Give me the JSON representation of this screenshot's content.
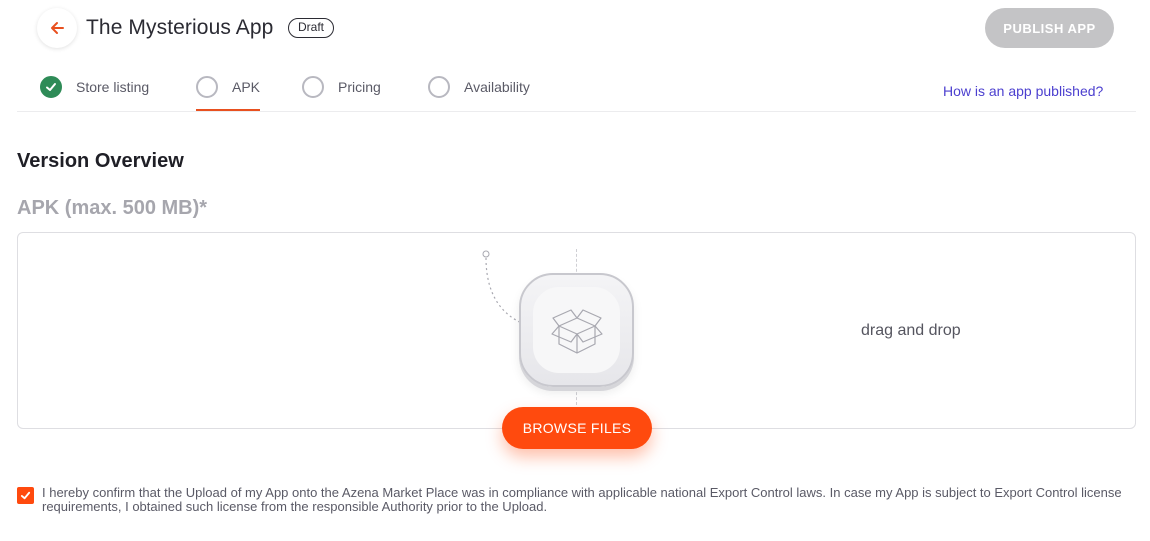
{
  "header": {
    "app_title": "The Mysterious App",
    "status_badge": "Draft",
    "publish_label": "PUBLISH APP",
    "back_icon": "arrow-left-icon",
    "accent_color": "#e8501f"
  },
  "tabs": [
    {
      "label": "Store listing",
      "state": "done"
    },
    {
      "label": "APK",
      "state": "active"
    },
    {
      "label": "Pricing",
      "state": "pending"
    },
    {
      "label": "Availability",
      "state": "pending"
    }
  ],
  "help_link": "How is an app published?",
  "main": {
    "section_title": "Version Overview",
    "apk_label": "APK (max. 500 MB)*",
    "drag_text": "drag and drop",
    "browse_label": "BROWSE FILES",
    "box_icon": "package-box-icon"
  },
  "confirm": {
    "checked": true,
    "text": "I hereby confirm that the Upload of my App onto the Azena Market Place was in compliance with applicable national Export Control laws. In case my App is subject to Export Control license requirements, I obtained such license from the responsible Authority prior to the Upload."
  },
  "colors": {
    "primary": "#ff4a0e",
    "success": "#2e8b57",
    "link": "#4b3fcf",
    "disabled": "#c4c4c6"
  }
}
